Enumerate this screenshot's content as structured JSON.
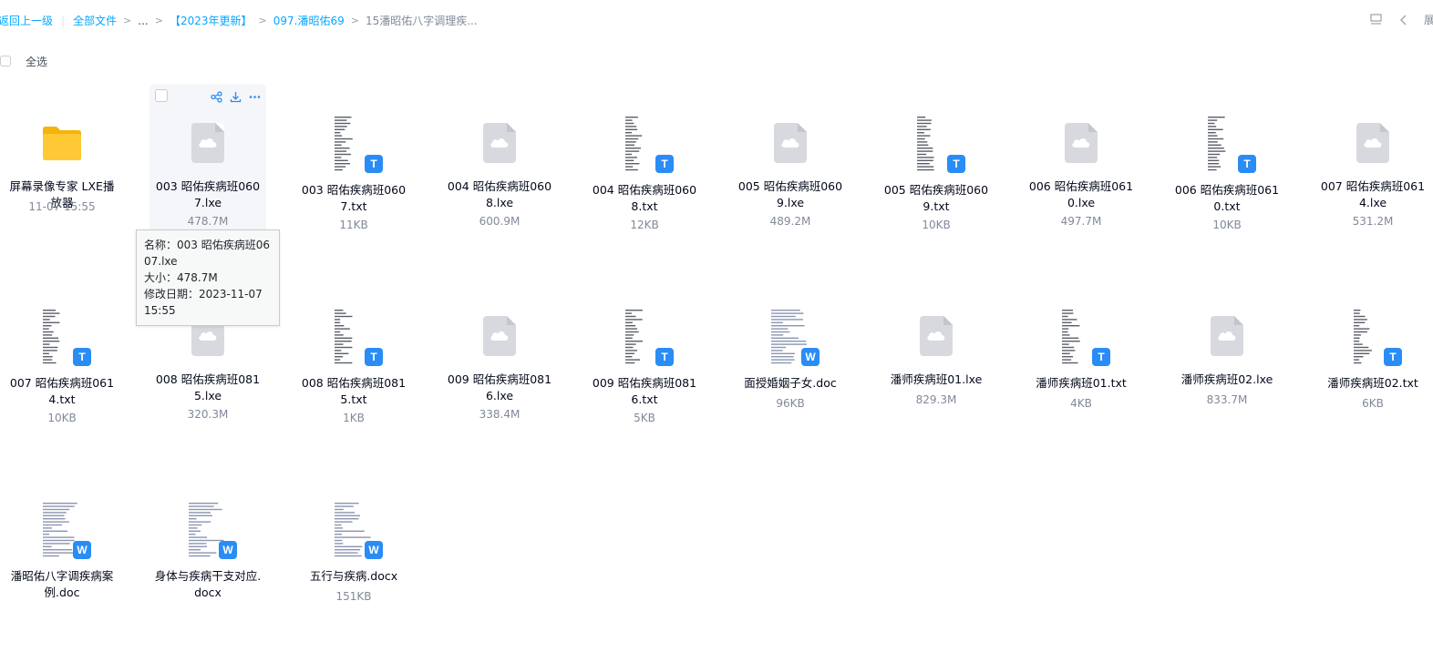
{
  "breadcrumb": {
    "back": "返回上一级",
    "all_files": "全部文件",
    "ellipsis": "...",
    "level1": "【2023年更新】",
    "level2": "097.潘昭佑69",
    "current": "15潘昭佑八字调理疾..."
  },
  "toolbar": {
    "expand_label": "展",
    "list_icon": "list-view-icon",
    "prev_icon": "chevron-left-icon"
  },
  "select_all": "全选",
  "tooltip": {
    "name_line": "名称：003 昭佑疾病班0607.lxe",
    "size_line": "大小：478.7M",
    "date_line": "修改日期：2023-11-07 15:55"
  },
  "files": [
    {
      "name": "屏幕录像专家 LXE播放器",
      "meta": "11-07 15:55",
      "kind": "folder"
    },
    {
      "name": "003 昭佑疾病班0607.lxe",
      "meta": "478.7M",
      "kind": "cloud",
      "hover": true
    },
    {
      "name": "003 昭佑疾病班0607.txt",
      "meta": "11KB",
      "kind": "txt"
    },
    {
      "name": "004 昭佑疾病班0608.lxe",
      "meta": "600.9M",
      "kind": "cloud"
    },
    {
      "name": "004 昭佑疾病班0608.txt",
      "meta": "12KB",
      "kind": "txt"
    },
    {
      "name": "005 昭佑疾病班0609.lxe",
      "meta": "489.2M",
      "kind": "cloud"
    },
    {
      "name": "005 昭佑疾病班0609.txt",
      "meta": "10KB",
      "kind": "txt"
    },
    {
      "name": "006 昭佑疾病班0610.lxe",
      "meta": "497.7M",
      "kind": "cloud"
    },
    {
      "name": "006 昭佑疾病班0610.txt",
      "meta": "10KB",
      "kind": "txt"
    },
    {
      "name": "007 昭佑疾病班0614.lxe",
      "meta": "531.2M",
      "kind": "cloud"
    },
    {
      "name": "007 昭佑疾病班0614.txt",
      "meta": "10KB",
      "kind": "txt"
    },
    {
      "name": "008 昭佑疾病班0815.lxe",
      "meta": "320.3M",
      "kind": "cloud"
    },
    {
      "name": "008 昭佑疾病班0815.txt",
      "meta": "1KB",
      "kind": "txt"
    },
    {
      "name": "009 昭佑疾病班0816.lxe",
      "meta": "338.4M",
      "kind": "cloud"
    },
    {
      "name": "009 昭佑疾病班0816.txt",
      "meta": "5KB",
      "kind": "txt"
    },
    {
      "name": "面授婚姻子女.doc",
      "meta": "96KB",
      "kind": "doc"
    },
    {
      "name": "潘师疾病班01.lxe",
      "meta": "829.3M",
      "kind": "cloud"
    },
    {
      "name": "潘师疾病班01.txt",
      "meta": "4KB",
      "kind": "txt"
    },
    {
      "name": "潘师疾病班02.lxe",
      "meta": "833.7M",
      "kind": "cloud"
    },
    {
      "name": "潘师疾病班02.txt",
      "meta": "6KB",
      "kind": "txt"
    },
    {
      "name": "潘昭佑八字调疾病案例.doc",
      "meta": "",
      "kind": "doc"
    },
    {
      "name": "身体与疾病干支对应.docx",
      "meta": "",
      "kind": "doc"
    },
    {
      "name": "五行与疾病.docx",
      "meta": "151KB",
      "kind": "doc"
    }
  ],
  "badges": {
    "txt": "T",
    "doc": "W"
  },
  "colors": {
    "link": "#06a7ff",
    "badge": "#2a8cf5",
    "folder": "#ffc935"
  }
}
